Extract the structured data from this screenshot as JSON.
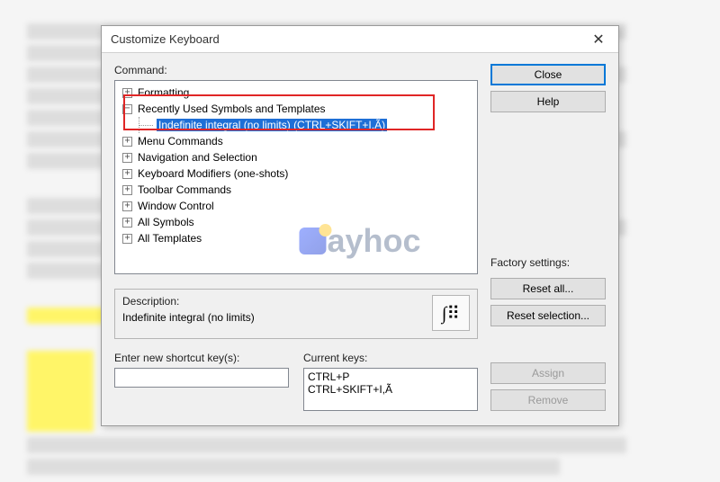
{
  "dialog": {
    "title": "Customize Keyboard",
    "command_label": "Command:",
    "tree": {
      "items": [
        {
          "label": "Formatting",
          "expanded": false
        },
        {
          "label": "Recently Used Symbols and Templates",
          "expanded": true,
          "child": "Indefinite integral (no limits) (CTRL+SKIFT+I,Ã)"
        },
        {
          "label": "Menu Commands",
          "expanded": false
        },
        {
          "label": "Navigation and Selection",
          "expanded": false
        },
        {
          "label": "Keyboard Modifiers (one-shots)",
          "expanded": false
        },
        {
          "label": "Toolbar Commands",
          "expanded": false
        },
        {
          "label": "Window Control",
          "expanded": false
        },
        {
          "label": "All Symbols",
          "expanded": false
        },
        {
          "label": "All Templates",
          "expanded": false
        }
      ]
    },
    "description_label": "Description:",
    "description_text": "Indefinite integral (no limits)",
    "integral_glyph": "∫⠿",
    "shortcut_label": "Enter new shortcut key(s):",
    "shortcut_value": "",
    "currentkeys_label": "Current keys:",
    "current_keys": [
      "CTRL+P",
      "CTRL+SKIFT+I,Ã"
    ],
    "buttons": {
      "close": "Close",
      "help": "Help",
      "factory_label": "Factory settings:",
      "reset_all": "Reset all...",
      "reset_selection": "Reset selection...",
      "assign": "Assign",
      "remove": "Remove"
    }
  },
  "watermark": "ayhoc"
}
